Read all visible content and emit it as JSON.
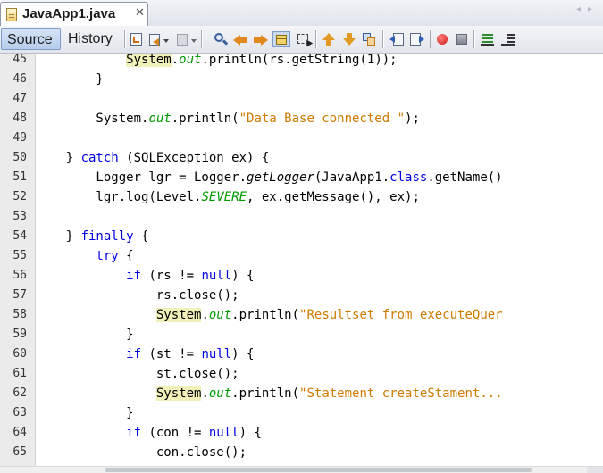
{
  "tab": {
    "title": "JavaApp1.java",
    "close_glyph": "✕",
    "nav_glyphs": "◂▸"
  },
  "toolbar": {
    "source_label": "Source",
    "history_label": "History",
    "icons": [
      "last-edit-icon",
      "back-icon",
      "forward-dropdown-icon",
      "find-selection-icon",
      "find-previous-icon",
      "find-next-icon",
      "toggle-highlight-icon",
      "toggle-rect-select-icon",
      "shift-up-icon",
      "shift-down-icon",
      "comment-icon",
      "uncomment-icon",
      "macro-record-icon",
      "macro-stop-icon",
      "diff-icon",
      "format-icon"
    ]
  },
  "editor": {
    "line_numbers": [
      "45",
      "46",
      "47",
      "48",
      "49",
      "50",
      "51",
      "52",
      "53",
      "54",
      "55",
      "56",
      "57",
      "58",
      "59",
      "60",
      "61",
      "62",
      "63",
      "64",
      "65"
    ],
    "lines": [
      [
        {
          "t": "            "
        },
        {
          "t": "System",
          "c": "hl"
        },
        {
          "t": "."
        },
        {
          "t": "out",
          "c": "fld"
        },
        {
          "t": ".println(rs.getString(1));"
        }
      ],
      [
        {
          "t": "        }"
        }
      ],
      [
        {
          "t": ""
        }
      ],
      [
        {
          "t": "        System."
        },
        {
          "t": "out",
          "c": "fld"
        },
        {
          "t": ".println("
        },
        {
          "t": "\"Data Base connected \"",
          "c": "str"
        },
        {
          "t": ");"
        }
      ],
      [
        {
          "t": ""
        }
      ],
      [
        {
          "t": "    } "
        },
        {
          "t": "catch",
          "c": "kw"
        },
        {
          "t": " (SQLException ex) {"
        }
      ],
      [
        {
          "t": "        Logger lgr = Logger."
        },
        {
          "t": "getLogger",
          "c": "ital"
        },
        {
          "t": "(JavaApp1."
        },
        {
          "t": "class",
          "c": "kw"
        },
        {
          "t": ".getName()"
        }
      ],
      [
        {
          "t": "        lgr.log(Level."
        },
        {
          "t": "SEVERE",
          "c": "fld"
        },
        {
          "t": ", ex.getMessage(), ex);"
        }
      ],
      [
        {
          "t": ""
        }
      ],
      [
        {
          "t": "    } "
        },
        {
          "t": "finally",
          "c": "kw"
        },
        {
          "t": " {"
        }
      ],
      [
        {
          "t": "        "
        },
        {
          "t": "try",
          "c": "kw"
        },
        {
          "t": " {"
        }
      ],
      [
        {
          "t": "            "
        },
        {
          "t": "if",
          "c": "kw"
        },
        {
          "t": " (rs != "
        },
        {
          "t": "null",
          "c": "kw"
        },
        {
          "t": ") {"
        }
      ],
      [
        {
          "t": "                rs.close();"
        }
      ],
      [
        {
          "t": "                "
        },
        {
          "t": "System",
          "c": "hl"
        },
        {
          "t": "."
        },
        {
          "t": "out",
          "c": "fld"
        },
        {
          "t": ".println("
        },
        {
          "t": "\"Resultset from executeQuer",
          "c": "str"
        }
      ],
      [
        {
          "t": "            }"
        }
      ],
      [
        {
          "t": "            "
        },
        {
          "t": "if",
          "c": "kw"
        },
        {
          "t": " (st != "
        },
        {
          "t": "null",
          "c": "kw"
        },
        {
          "t": ") {"
        }
      ],
      [
        {
          "t": "                st.close();"
        }
      ],
      [
        {
          "t": "                "
        },
        {
          "t": "System",
          "c": "hl"
        },
        {
          "t": "."
        },
        {
          "t": "out",
          "c": "fld"
        },
        {
          "t": ".println("
        },
        {
          "t": "\"Statement createStament...",
          "c": "str"
        }
      ],
      [
        {
          "t": "            }"
        }
      ],
      [
        {
          "t": "            "
        },
        {
          "t": "if",
          "c": "kw"
        },
        {
          "t": " (con != "
        },
        {
          "t": "null",
          "c": "kw"
        },
        {
          "t": ") {"
        }
      ],
      [
        {
          "t": "                con.close();"
        }
      ]
    ]
  }
}
